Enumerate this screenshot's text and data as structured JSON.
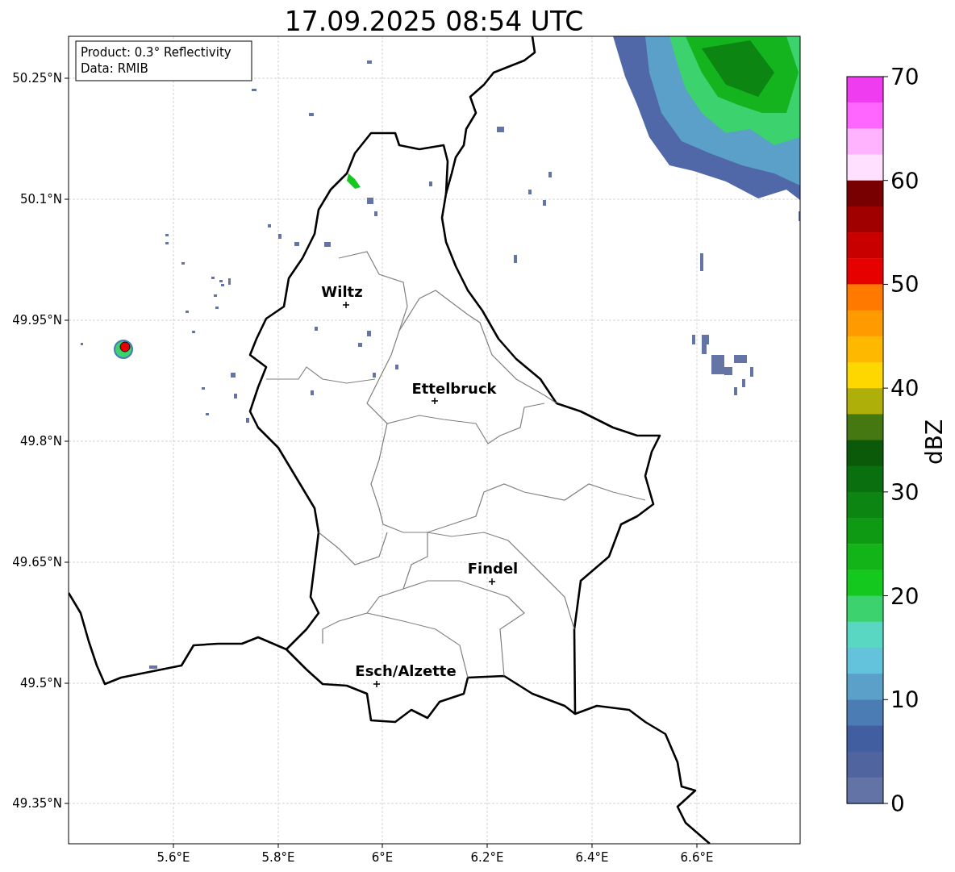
{
  "title": "17.09.2025 08:54 UTC",
  "info_box": {
    "lines": [
      "Product: 0.3° Reflectivity",
      "Data: RMIB"
    ]
  },
  "map": {
    "lat_ticks": [
      "50.25°N",
      "50.1°N",
      "49.95°N",
      "49.8°N",
      "49.65°N",
      "49.5°N",
      "49.35°N"
    ],
    "lon_ticks": [
      "5.6°E",
      "5.8°E",
      "6°E",
      "6.2°E",
      "6.4°E",
      "6.6°E"
    ],
    "cities": [
      {
        "name": "Wiltz"
      },
      {
        "name": "Ettelbruck"
      },
      {
        "name": "Findel"
      },
      {
        "name": "Esch/Alzette"
      }
    ]
  },
  "colorbar": {
    "label": "dBZ",
    "ticks": [
      "70",
      "60",
      "50",
      "40",
      "30",
      "20",
      "10",
      "0"
    ],
    "segments": [
      {
        "color": "#f03cf0"
      },
      {
        "color": "#ff66ff"
      },
      {
        "color": "#ffb3ff"
      },
      {
        "color": "#ffe0ff"
      },
      {
        "color": "#780000"
      },
      {
        "color": "#a00000"
      },
      {
        "color": "#c80000"
      },
      {
        "color": "#e60000"
      },
      {
        "color": "#ff7800"
      },
      {
        "color": "#ff9b00"
      },
      {
        "color": "#ffb800"
      },
      {
        "color": "#ffd700"
      },
      {
        "color": "#afaf0a"
      },
      {
        "color": "#467812"
      },
      {
        "color": "#0a5a0a"
      },
      {
        "color": "#0a700f"
      },
      {
        "color": "#0c8512"
      },
      {
        "color": "#0f9a14"
      },
      {
        "color": "#12b418"
      },
      {
        "color": "#14c81e"
      },
      {
        "color": "#3cd26e"
      },
      {
        "color": "#5ad7c3"
      },
      {
        "color": "#64c3dc"
      },
      {
        "color": "#5aa0c8"
      },
      {
        "color": "#4b7db4"
      },
      {
        "color": "#415fa0"
      },
      {
        "color": "#5064a0"
      },
      {
        "color": "#6473a5"
      }
    ]
  }
}
